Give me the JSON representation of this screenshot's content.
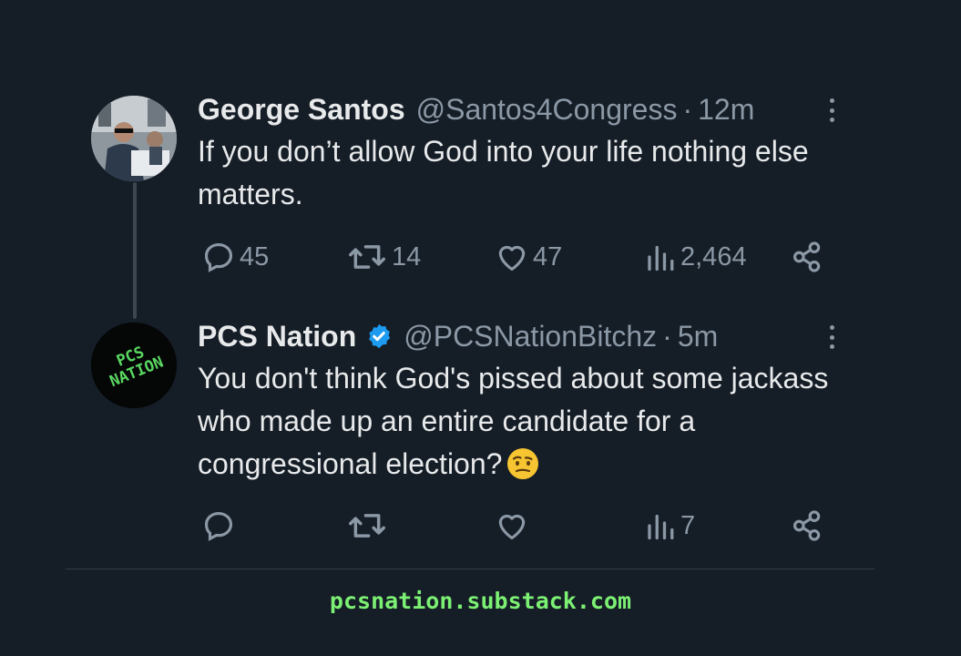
{
  "tweets": [
    {
      "name": "George Santos",
      "handle": "@Santos4Congress",
      "separator": "·",
      "time": "12m",
      "verified": false,
      "text": "If you don’t allow God into your life nothing else matters.",
      "stats": {
        "replies": "45",
        "retweets": "14",
        "likes": "47",
        "views": "2,464"
      }
    },
    {
      "name": "PCS Nation",
      "handle": "@PCSNationBitchz",
      "separator": "·",
      "time": "5m",
      "verified": true,
      "text": "You don't think God's pissed about some jackass who made up an entire candidate for a congressional election?",
      "stats": {
        "replies": "",
        "retweets": "",
        "likes": "",
        "views": "7"
      }
    }
  ],
  "avatar2_text": "PCS NATION",
  "footer": "pcsnation.substack.com",
  "colors": {
    "background": "#151d27",
    "text": "#e7e9ea",
    "muted": "#8b98a5",
    "verified": "#1d9bf0",
    "footer": "#7cf073"
  },
  "icons": [
    "reply-icon",
    "retweet-icon",
    "like-icon",
    "views-icon",
    "share-icon",
    "more-icon",
    "verified-badge-icon",
    "raised-eyebrow-emoji"
  ]
}
